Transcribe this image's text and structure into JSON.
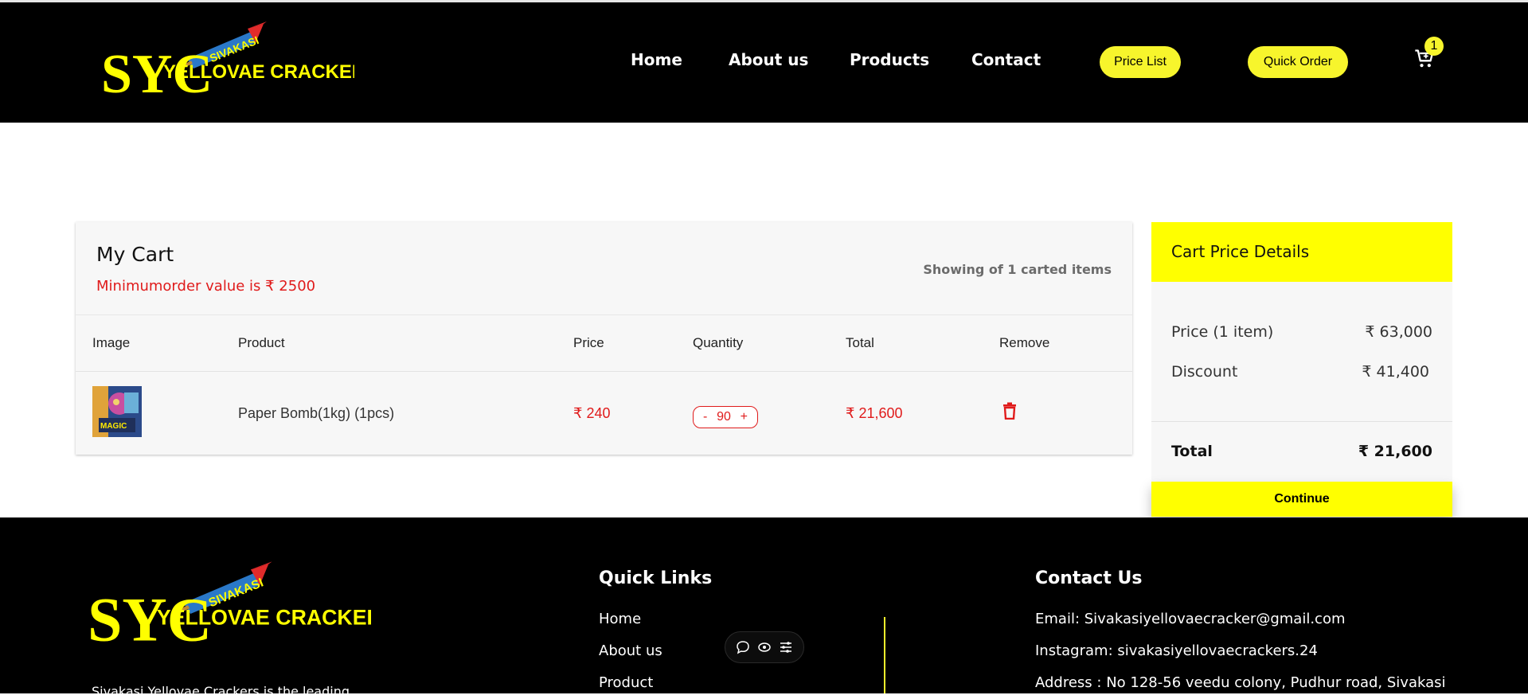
{
  "brand": {
    "logo_text": "YELLOVAE CRACKERS",
    "logo_tag": "SIVAKASI",
    "logo_mono": "SYC"
  },
  "nav": {
    "items": [
      "Home",
      "About us",
      "Products",
      "Contact"
    ],
    "price_list": "Price List",
    "quick_order": "Quick Order",
    "cart_count": "1"
  },
  "cart": {
    "title": "My Cart",
    "min_order": "Minimumorder value is ₹ 2500",
    "showing": "Showing of 1 carted items",
    "columns": [
      "Image",
      "Product",
      "Price",
      "Quantity",
      "Total",
      "Remove"
    ],
    "rows": [
      {
        "product": "Paper Bomb(1kg) (1pcs)",
        "price": "₹ 240",
        "qty_minus": "-",
        "qty": "90",
        "qty_plus": "+",
        "total": "₹ 21,600",
        "image_caption": "MAGIC"
      }
    ]
  },
  "price_details": {
    "title": "Cart Price Details",
    "price_label": "Price (1 item)",
    "price_value": "₹ 63,000",
    "discount_label": "Discount",
    "discount_value": "₹ 41,400",
    "total_label": "Total",
    "total_value": "₹ 21,600",
    "continue": "Continue"
  },
  "footer": {
    "quick_links_title": "Quick Links",
    "quick_links": [
      "Home",
      "About us",
      "Product"
    ],
    "contact_title": "Contact Us",
    "contact": [
      "Email: Sivakasiyellovaecracker@gmail.com",
      "Instagram: sivakasiyellovaecrackers.24",
      "Address : No 128-56 veedu colony, Pudhur road, Sivakasi"
    ],
    "about_text": "Sivakasi Yellovae Crackers is the leading"
  },
  "colors": {
    "accent_yellow": "#ffff00",
    "pill_yellow": "#f7f52c",
    "price_red": "#e01b1b",
    "header_bg": "#000000"
  },
  "icons": {
    "cart": "cart-icon",
    "trash": "trash-icon",
    "chat": "chat-icon",
    "eye": "eye-icon",
    "settings": "sliders-icon"
  }
}
